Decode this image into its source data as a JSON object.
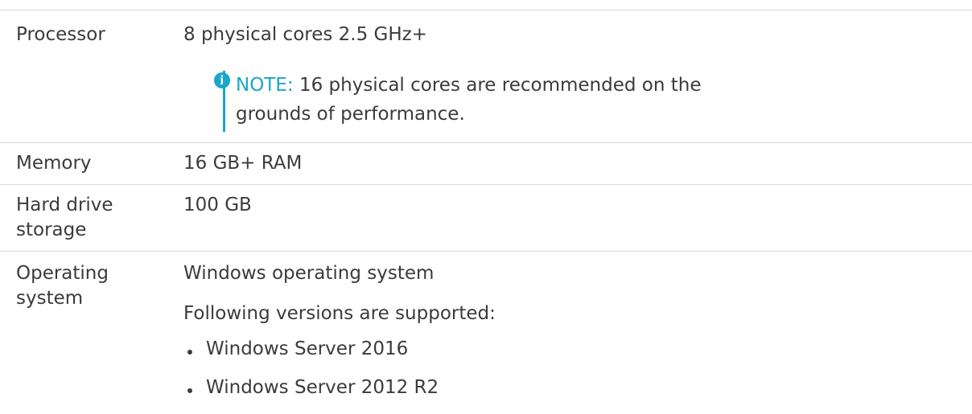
{
  "rows": {
    "processor": {
      "label": "Processor",
      "value": "8 physical cores 2.5 GHz+",
      "note": {
        "icon": "info-icon",
        "prefix": "NOTE:",
        "text": "16 physical cores are recommended on the grounds of performance."
      }
    },
    "memory": {
      "label": "Memory",
      "value": "16 GB+ RAM"
    },
    "storage": {
      "label": "Hard drive storage",
      "value": "100 GB"
    },
    "os": {
      "label": "Operating system",
      "value": "Windows operating system",
      "supported_intro": "Following versions are supported:",
      "versions": [
        "Windows Server 2016",
        "Windows Server 2012 R2"
      ]
    }
  },
  "colors": {
    "accent": "#1aa6c9",
    "text": "#3b3b3b",
    "divider": "#d9d9d9"
  }
}
